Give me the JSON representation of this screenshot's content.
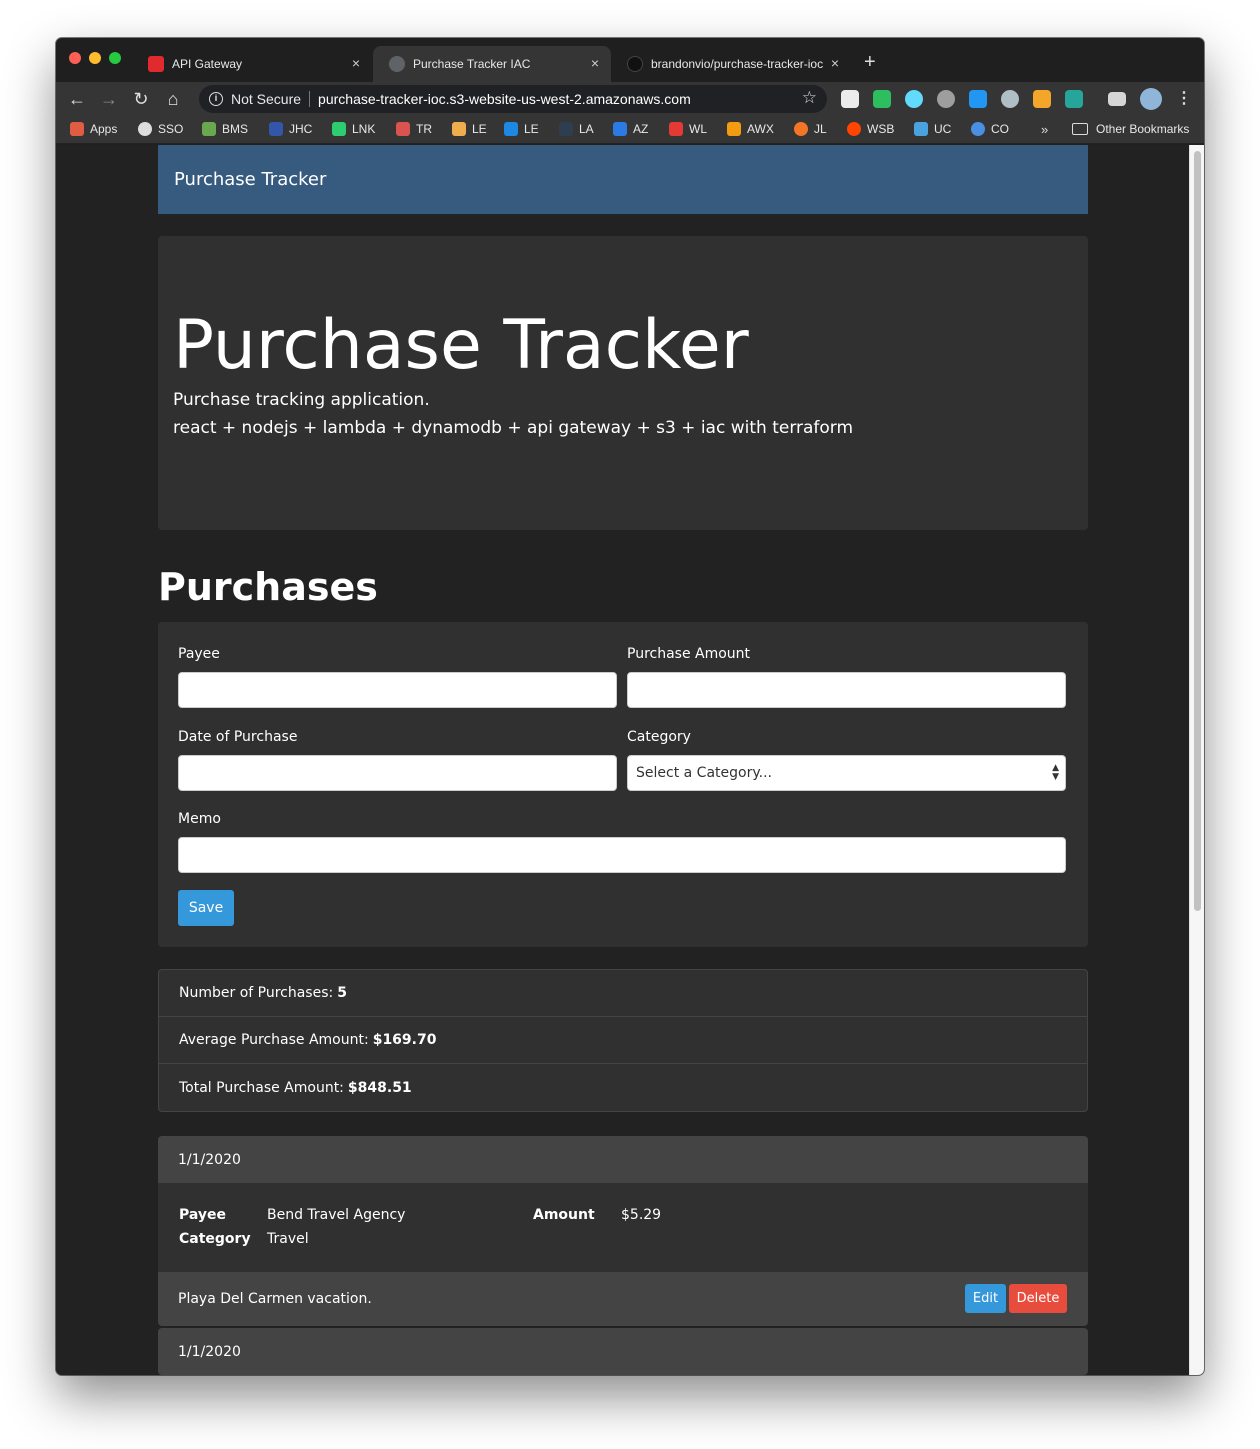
{
  "browser": {
    "tabs": [
      {
        "title": "API Gateway",
        "favicon": "api-gateway-icon",
        "color": "#e02a2f"
      },
      {
        "title": "Purchase Tracker IAC",
        "favicon": "globe-icon",
        "color": "#666666"
      },
      {
        "title": "brandonvio/purchase-tracker-ioc",
        "favicon": "github-icon",
        "color": "#222222"
      }
    ],
    "close_glyph": "×",
    "new_tab_glyph": "+",
    "omnibox": {
      "security_label": "Not Secure",
      "url": "purchase-tracker-ioc.s3-website-us-west-2.amazonaws.com"
    },
    "bookmarks": [
      {
        "label": "Apps",
        "icon": "apps-grid-icon",
        "color": "#e05d44"
      },
      {
        "label": "SSO",
        "icon": "globe-icon",
        "color": "#dddddd"
      },
      {
        "label": "BMS",
        "icon": "bms-icon",
        "color": "#6aa84f"
      },
      {
        "label": "JHC",
        "icon": "shield-icon",
        "color": "#3355aa"
      },
      {
        "label": "LNK",
        "icon": "lnk-icon",
        "color": "#2ecc71"
      },
      {
        "label": "TR",
        "icon": "tr-icon",
        "color": "#d9534f"
      },
      {
        "label": "LE",
        "icon": "le-icon",
        "color": "#f0ad4e"
      },
      {
        "label": "LE",
        "icon": "le-play-icon",
        "color": "#1e88e5"
      },
      {
        "label": "LA",
        "icon": "la-icon",
        "color": "#2c3e50"
      },
      {
        "label": "AZ",
        "icon": "azure-icon",
        "color": "#2c7be5"
      },
      {
        "label": "WL",
        "icon": "wl-icon",
        "color": "#e53935"
      },
      {
        "label": "AWX",
        "icon": "awx-icon",
        "color": "#f39c12"
      },
      {
        "label": "JL",
        "icon": "jupyter-icon",
        "color": "#f37626"
      },
      {
        "label": "WSB",
        "icon": "reddit-icon",
        "color": "#ff4500"
      },
      {
        "label": "UC",
        "icon": "uc-icon",
        "color": "#4aa3df"
      },
      {
        "label": "CO",
        "icon": "co-icon",
        "color": "#4a90e2"
      }
    ],
    "bookmarks_more": "»",
    "other_bookmarks": "Other Bookmarks"
  },
  "app": {
    "navbar_brand": "Purchase Tracker",
    "jumbotron": {
      "title": "Purchase Tracker",
      "line1": "Purchase tracking application.",
      "line2": "react + nodejs + lambda + dynamodb + api gateway + s3 + iac with terraform"
    },
    "section_title": "Purchases",
    "form": {
      "payee_label": "Payee",
      "amount_label": "Purchase Amount",
      "date_label": "Date of Purchase",
      "category_label": "Category",
      "category_selected": "Select a Category...",
      "memo_label": "Memo",
      "save_label": "Save"
    },
    "stats": {
      "count_label": "Number of Purchases:",
      "count_value": "5",
      "avg_label": "Average Purchase Amount:",
      "avg_value": "$169.70",
      "total_label": "Total Purchase Amount:",
      "total_value": "$848.51"
    },
    "purchases": [
      {
        "date": "1/1/2020",
        "payee_label": "Payee",
        "payee": "Bend Travel Agency",
        "category_label": "Category",
        "category": "Travel",
        "amount_label": "Amount",
        "amount": "$5.29",
        "memo": "Playa Del Carmen vacation.",
        "edit_label": "Edit",
        "delete_label": "Delete"
      },
      {
        "date": "1/1/2020"
      }
    ]
  }
}
